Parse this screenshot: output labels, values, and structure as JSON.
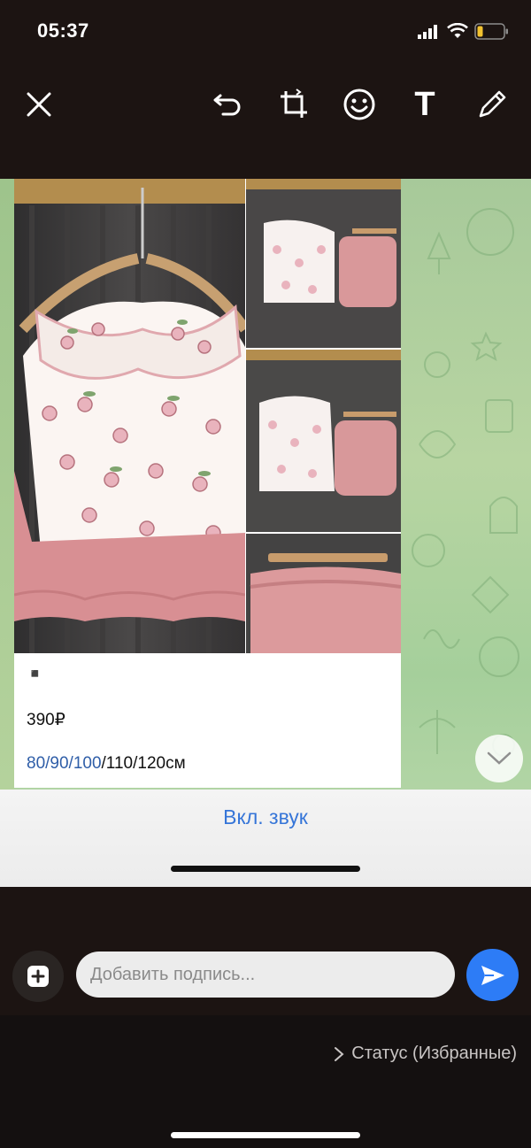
{
  "status_bar": {
    "time": "05:37"
  },
  "toolbar": {
    "close": "close-icon",
    "undo": "undo-icon",
    "crop": "crop-rotate-icon",
    "sticker": "smiley-icon",
    "text": "T",
    "draw": "pencil-icon"
  },
  "message": {
    "emoji": "◾",
    "price": "390₽",
    "sizes_linked": "80/90/100",
    "sizes_rest": "/110/120см"
  },
  "sound_toggle": "Вкл. звук",
  "caption": {
    "placeholder": "Добавить подпись..."
  },
  "recipient": "Статус (Избранные)",
  "colors": {
    "accent": "#2d7cf6",
    "link": "#3575d8",
    "dark_bg": "#1c1412",
    "battery": "#f2c230"
  }
}
